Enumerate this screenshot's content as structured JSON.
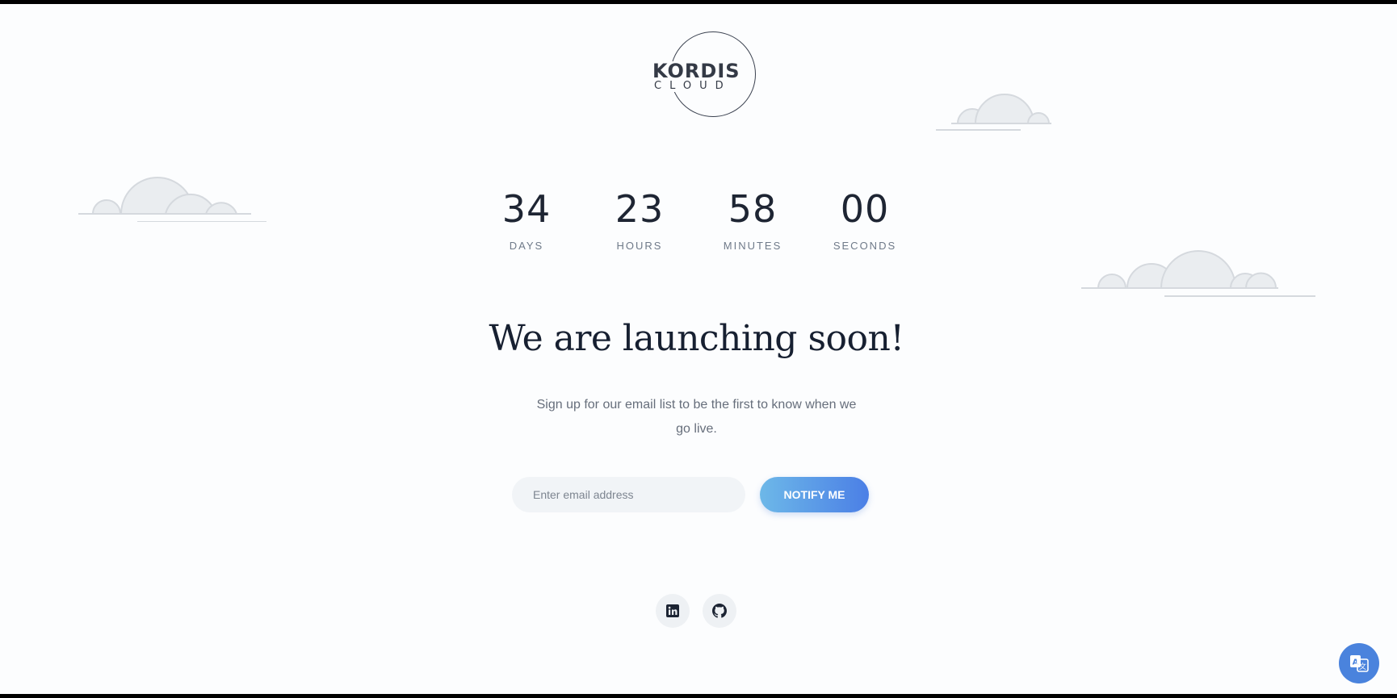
{
  "brand": {
    "name": "KORDIS",
    "tagline": "CLOUD"
  },
  "countdown": [
    {
      "value": "34",
      "label": "DAYS"
    },
    {
      "value": "23",
      "label": "HOURS"
    },
    {
      "value": "58",
      "label": "MINUTES"
    },
    {
      "value": "00",
      "label": "SECONDS"
    }
  ],
  "headline": "We are launching soon!",
  "subtext": "Sign up for our email list to be the first to know when we go live.",
  "signup": {
    "placeholder": "Enter email address",
    "button_label": "NOTIFY ME"
  },
  "social": [
    {
      "icon": "linkedin-icon"
    },
    {
      "icon": "github-icon"
    }
  ],
  "language_button": {
    "icon": "translate-icon"
  },
  "colors": {
    "background": "#fcfdfe",
    "text_dark": "#172031",
    "text_muted": "#6f7a89",
    "button_gradient_start": "#6db8e8",
    "button_gradient_end": "#4b7fe6",
    "language_button": "#4a83dd"
  }
}
